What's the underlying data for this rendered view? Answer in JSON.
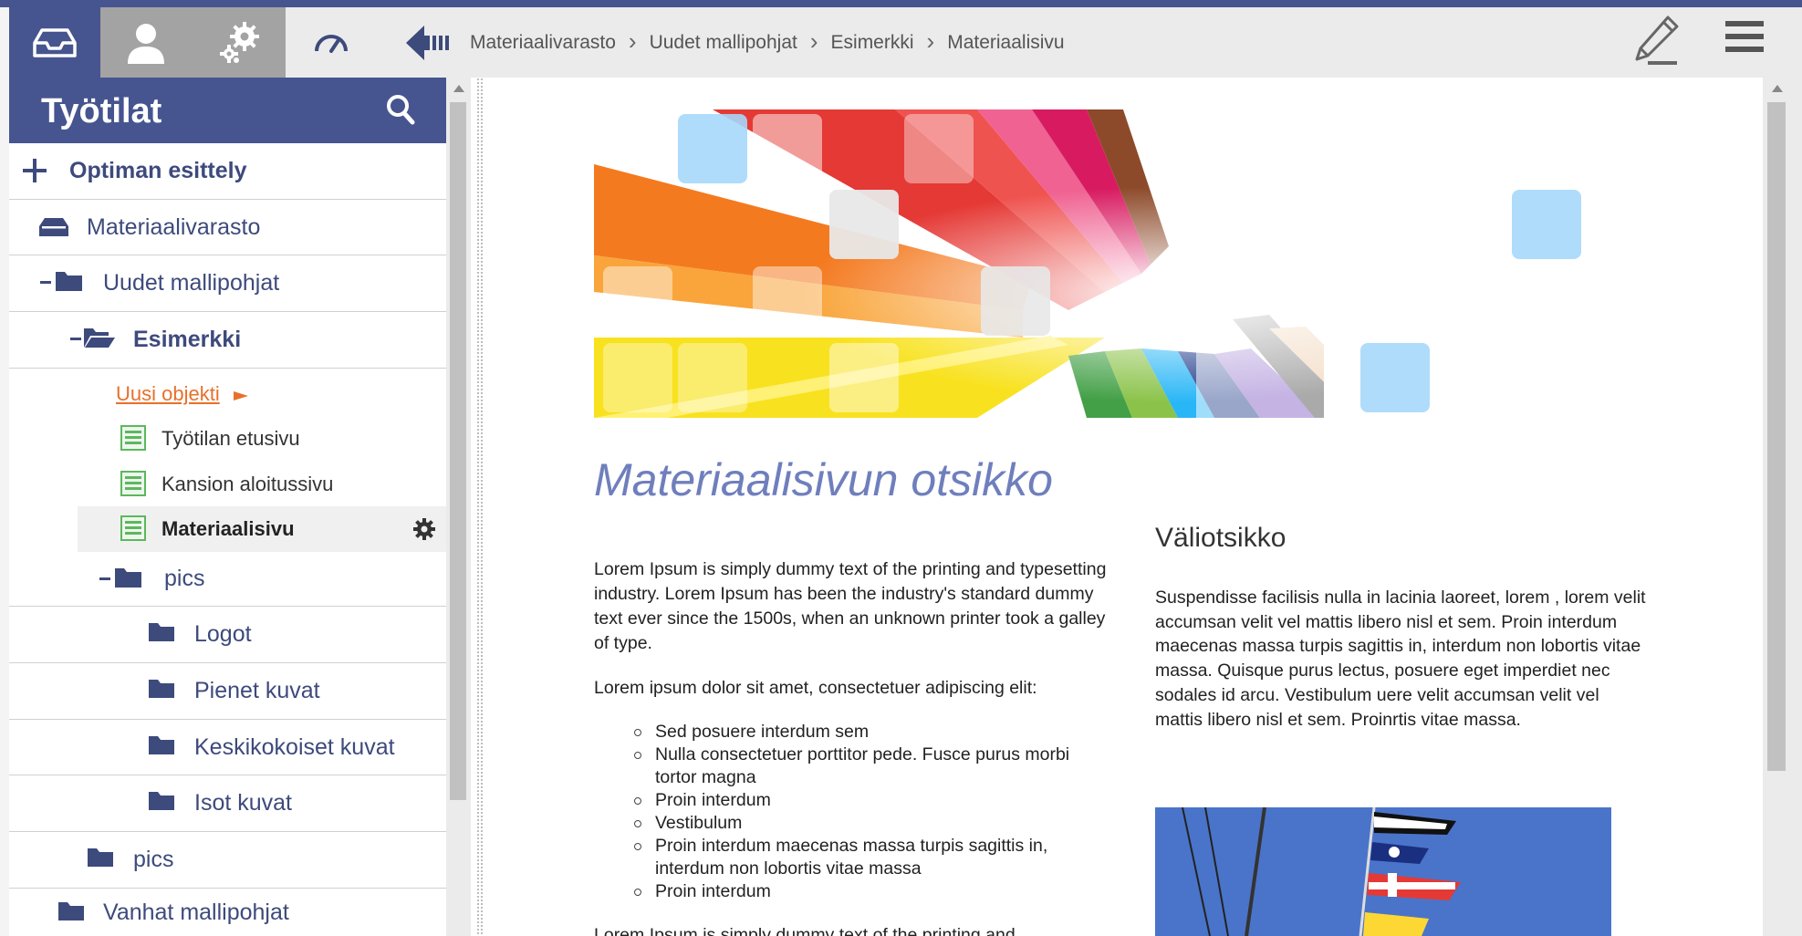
{
  "topbar": {
    "breadcrumb": [
      "Materiaalivarasto",
      "Uudet mallipohjat",
      "Esimerkki",
      "Materiaalisivu"
    ]
  },
  "sidebar": {
    "title": "Työtilat",
    "tree": [
      {
        "label": "Optiman esittely"
      },
      {
        "label": "Materiaalivarasto"
      },
      {
        "label": "Uudet mallipohjat"
      },
      {
        "label": "Esimerkki"
      },
      {
        "label": "Uusi objekti"
      },
      {
        "label": "Työtilan etusivu"
      },
      {
        "label": "Kansion aloitussivu"
      },
      {
        "label": "Materiaalisivu"
      },
      {
        "label": "pics"
      },
      {
        "label": "Logot"
      },
      {
        "label": "Pienet kuvat"
      },
      {
        "label": "Keskikokoiset kuvat"
      },
      {
        "label": "Isot kuvat"
      },
      {
        "label": "pics"
      },
      {
        "label": "Vanhat mallipohjat"
      }
    ]
  },
  "content": {
    "title": "Materiaalisivun otsikko",
    "paragraph1": "Lorem Ipsum is simply dummy text of the printing and typesetting industry. Lorem Ipsum has been the industry's standard dummy text ever since the 1500s, when an unknown printer took a galley of type.",
    "paragraph2": "Lorem ipsum dolor sit amet, consectetuer adipiscing elit:",
    "bullets": [
      "Sed posuere interdum sem",
      "Nulla consectetuer porttitor pede. Fusce purus morbi tortor magna",
      "Proin interdum",
      "Vestibulum",
      "Proin interdum maecenas massa turpis sagittis in, interdum non lobortis vitae massa",
      "Proin interdum"
    ],
    "paragraph3": "Lorem Ipsum is simply dummy text of the printing and",
    "subheading": "Väliotsikko",
    "right_paragraph": "Suspendisse facilisis nulla in lacinia laoreet, lorem , lorem velit accumsan velit vel mattis libero nisl et sem. Proin interdum maecenas massa turpis sagittis in, interdum non lobortis vitae massa. Quisque purus lectus, posuere eget imperdiet nec sodales id arcu. Vestibulum uere velit accumsan velit vel mattis libero nisl et sem. Proinrtis vitae massa."
  },
  "colors": {
    "brand": "#465590",
    "accent_title": "#6f7fbd",
    "tree_text": "#3d4a7c",
    "new_object": "#e8702a",
    "page_icon": "#5cb85c"
  },
  "icons": [
    "inbox-icon",
    "user-icon",
    "gears-icon",
    "dashboard-icon",
    "collapse-left-icon",
    "pencil-icon",
    "hamburger-icon",
    "search-icon",
    "plus-icon",
    "drawer-icon",
    "folder-icon",
    "folder-open-icon",
    "page-icon",
    "gear-icon",
    "arrow-right-icon"
  ]
}
